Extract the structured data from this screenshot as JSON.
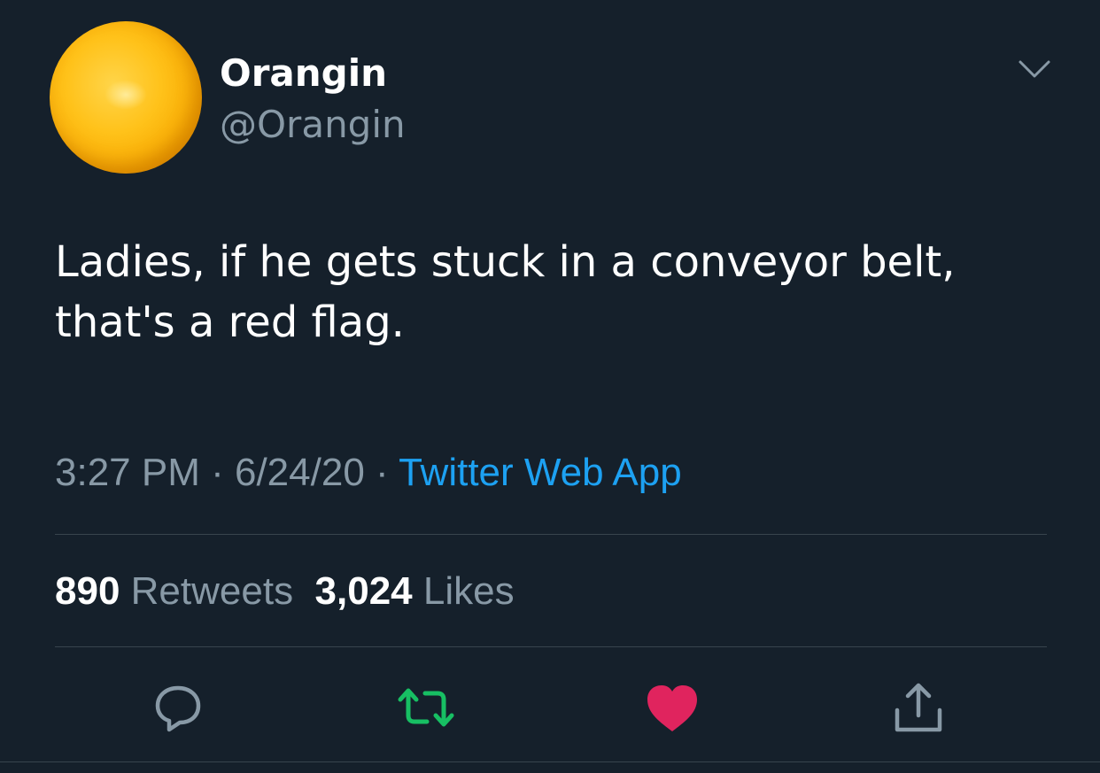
{
  "tweet": {
    "display_name": "Orangin",
    "handle": "@Orangin",
    "text_lines": [
      "Ladies, if he gets stuck in a conveyor belt,",
      "that's a red flag."
    ],
    "time": "3:27 PM",
    "separator": " · ",
    "date": "6/24/20",
    "source": "Twitter Web App",
    "retweets": {
      "count": "890",
      "label": "Retweets"
    },
    "likes": {
      "count": "3,024",
      "label": "Likes"
    }
  },
  "icons": {
    "more": "chevron-down-icon",
    "reply": "reply-icon",
    "retweet": "retweet-icon",
    "like": "heart-icon",
    "share": "share-icon"
  },
  "colors": {
    "background": "#15202b",
    "secondary_text": "#8899a6",
    "link": "#1da1f2",
    "retweet_active": "#17bf63",
    "like_active": "#e0245e",
    "divider": "#38444d",
    "avatar": "#ffc21a"
  }
}
